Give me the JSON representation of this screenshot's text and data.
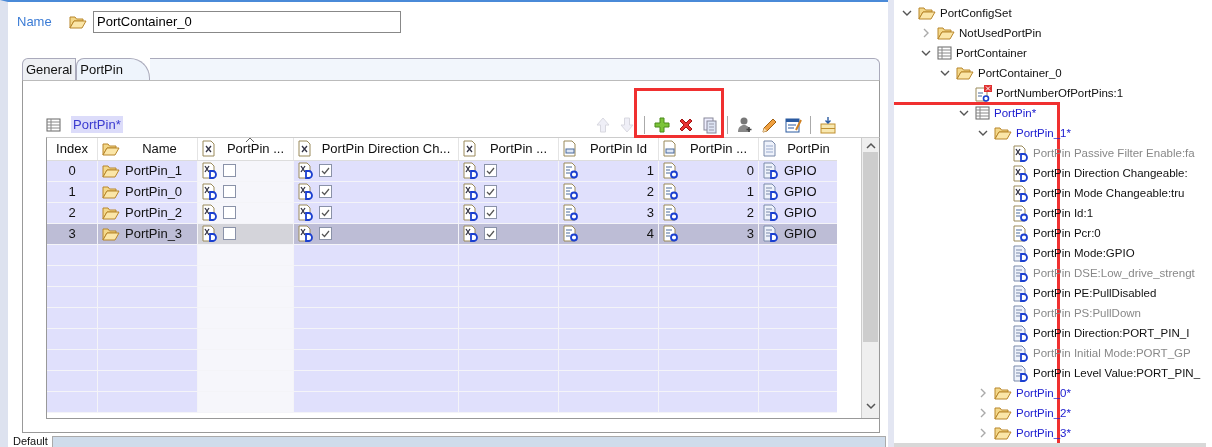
{
  "name_field": {
    "label": "Name",
    "value": "PortContainer_0"
  },
  "tabs": [
    {
      "label": "General",
      "selected": false
    },
    {
      "label": "PortPin",
      "selected": true
    }
  ],
  "table_title": {
    "text": "PortPin*",
    "modified": true
  },
  "toolbar": [
    {
      "framed": false,
      "items": [
        {
          "kind": "up",
          "disabled": true
        },
        {
          "kind": "down",
          "disabled": true
        }
      ]
    },
    {
      "framed": true,
      "items": [
        {
          "kind": "add",
          "disabled": false
        },
        {
          "kind": "delete",
          "disabled": false
        },
        {
          "kind": "copy",
          "disabled": false
        }
      ]
    },
    {
      "framed": false,
      "items": [
        {
          "kind": "user",
          "disabled": false
        },
        {
          "kind": "edit",
          "disabled": false
        },
        {
          "kind": "form",
          "disabled": false
        }
      ]
    },
    {
      "framed": false,
      "items": [
        {
          "kind": "insert",
          "disabled": false
        }
      ]
    }
  ],
  "table": {
    "columns": [
      {
        "label": "Index",
        "kind": "index",
        "sorted": false
      },
      {
        "label": "Name",
        "kind": "name",
        "sorted": false
      },
      {
        "label": "PortPin ...",
        "kind": "bool",
        "sorted": true
      },
      {
        "label": "PortPin Direction Ch...",
        "kind": "bool",
        "sorted": false
      },
      {
        "label": "PortPin ...",
        "kind": "bool",
        "sorted": false
      },
      {
        "label": "PortPin Id",
        "kind": "int",
        "sorted": false
      },
      {
        "label": "PortPin ...",
        "kind": "int",
        "sorted": false
      },
      {
        "label": "PortPin",
        "kind": "enum",
        "sorted": false
      }
    ],
    "rows": [
      {
        "selected": false,
        "cells": [
          {
            "text": "0"
          },
          {
            "text": "PortPin_1"
          },
          {
            "checked": false
          },
          {
            "checked": true
          },
          {
            "checked": true
          },
          {
            "text": "1"
          },
          {
            "text": "0"
          },
          {
            "text": "GPIO"
          }
        ]
      },
      {
        "selected": false,
        "cells": [
          {
            "text": "1"
          },
          {
            "text": "PortPin_0"
          },
          {
            "checked": false
          },
          {
            "checked": true
          },
          {
            "checked": true
          },
          {
            "text": "2"
          },
          {
            "text": "1"
          },
          {
            "text": "GPIO"
          }
        ]
      },
      {
        "selected": false,
        "cells": [
          {
            "text": "2"
          },
          {
            "text": "PortPin_2"
          },
          {
            "checked": false
          },
          {
            "checked": true
          },
          {
            "checked": true
          },
          {
            "text": "3"
          },
          {
            "text": "2"
          },
          {
            "text": "GPIO"
          }
        ]
      },
      {
        "selected": true,
        "cells": [
          {
            "text": "3"
          },
          {
            "text": "PortPin_3"
          },
          {
            "checked": false
          },
          {
            "checked": true
          },
          {
            "checked": true
          },
          {
            "text": "4"
          },
          {
            "text": "3"
          },
          {
            "text": "GPIO"
          }
        ]
      }
    ]
  },
  "default_label": "Default",
  "tree": [
    {
      "kind": "folder",
      "label": "PortConfigSet",
      "expanded": true,
      "modified": false,
      "framed": false,
      "children": [
        {
          "kind": "folder",
          "label": "NotUsedPortPin",
          "expanded": false,
          "modified": false,
          "framed": false
        },
        {
          "kind": "table",
          "label": "PortContainer",
          "expanded": true,
          "modified": false,
          "framed": false,
          "children": [
            {
              "kind": "folder",
              "label": "PortContainer_0",
              "expanded": true,
              "modified": false,
              "framed": false,
              "children": [
                {
                  "kind": "error",
                  "label": "PortNumberOfPortPins:1",
                  "disabled": false,
                  "framed": false
                },
                {
                  "kind": "table",
                  "label": "PortPin*",
                  "expanded": true,
                  "modified": true,
                  "framed": true,
                  "children": [
                    {
                      "kind": "folder",
                      "label": "PortPin_1*",
                      "expanded": true,
                      "modified": true,
                      "framed": false,
                      "children": [
                        {
                          "kind": "bool",
                          "label": "PortPin Passive Filter Enable:fa",
                          "disabled": true
                        },
                        {
                          "kind": "bool",
                          "label": "PortPin Direction Changeable:",
                          "disabled": false
                        },
                        {
                          "kind": "bool",
                          "label": "PortPin Mode Changeable:tru",
                          "disabled": false
                        },
                        {
                          "kind": "int",
                          "label": "PortPin Id:1",
                          "disabled": false
                        },
                        {
                          "kind": "int",
                          "label": "PortPin Pcr:0",
                          "disabled": false
                        },
                        {
                          "kind": "enum",
                          "label": "PortPin Mode:GPIO",
                          "disabled": false
                        },
                        {
                          "kind": "enum",
                          "label": "PortPin DSE:Low_drive_strengt",
                          "disabled": true
                        },
                        {
                          "kind": "enum",
                          "label": "PortPin PE:PullDisabled",
                          "disabled": false
                        },
                        {
                          "kind": "enum",
                          "label": "PortPin PS:PullDown",
                          "disabled": true
                        },
                        {
                          "kind": "enum",
                          "label": "PortPin Direction:PORT_PIN_I",
                          "disabled": false
                        },
                        {
                          "kind": "enum",
                          "label": "PortPin Initial Mode:PORT_GP",
                          "disabled": true
                        },
                        {
                          "kind": "enum",
                          "label": "PortPin Level Value:PORT_PIN_",
                          "disabled": false
                        }
                      ]
                    },
                    {
                      "kind": "folder",
                      "label": "PortPin_0*",
                      "expanded": false,
                      "modified": true,
                      "framed": false
                    },
                    {
                      "kind": "folder",
                      "label": "PortPin_2*",
                      "expanded": false,
                      "modified": true,
                      "framed": false
                    },
                    {
                      "kind": "folder",
                      "label": "PortPin_3*",
                      "expanded": false,
                      "modified": true,
                      "framed": false
                    }
                  ]
                }
              ]
            }
          ]
        }
      ]
    }
  ]
}
